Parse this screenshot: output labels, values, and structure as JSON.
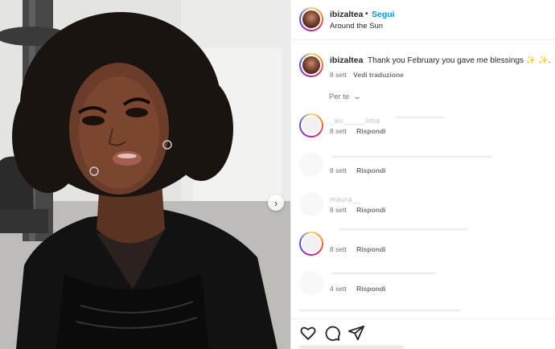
{
  "post": {
    "username": "ibizaltea",
    "separator": "•",
    "follow_label": "Segui",
    "audio": "Around the Sun"
  },
  "caption": {
    "username": "ibizaltea",
    "text": "Thank you February you gave me blessings ✨ ✨.",
    "time": "8 sett",
    "translate_label": "Vedi traduzione"
  },
  "filter_label": "Per te",
  "comments": [
    {
      "name": "_au_____lima",
      "time": "8 sett",
      "reply_label": "Rispondi"
    },
    {
      "name": "",
      "time": "8 sett",
      "reply_label": "Rispondi"
    },
    {
      "name": "maura__",
      "time": "8 sett",
      "reply_label": "Rispondi"
    },
    {
      "name": "",
      "time": "8 sett",
      "reply_label": "Rispondi"
    },
    {
      "name": "",
      "time": "4 sett",
      "reply_label": "Rispondi"
    }
  ],
  "icons": {
    "like": "heart-icon",
    "comment": "comment-icon",
    "share": "share-icon",
    "next": "chevron-right-icon"
  },
  "colors": {
    "follow": "#0095f6",
    "text": "#262626",
    "muted": "#737373"
  }
}
